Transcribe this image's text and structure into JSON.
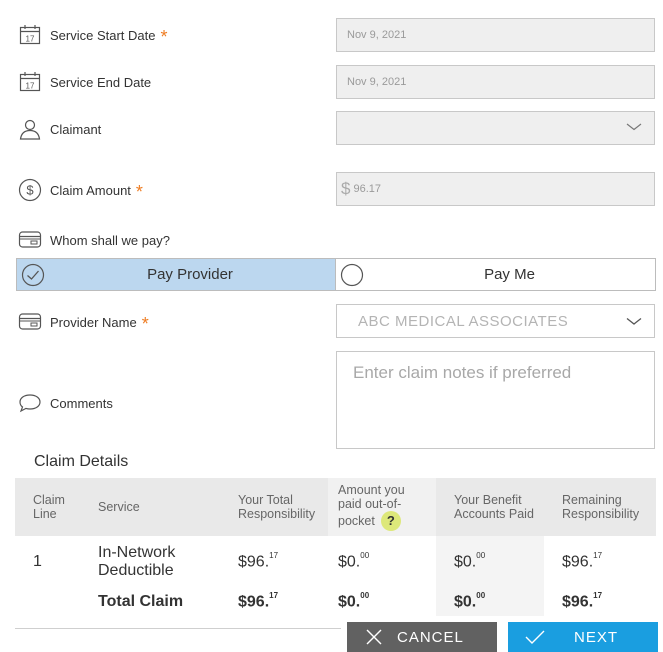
{
  "form": {
    "service_start_date": {
      "label": "Service Start Date",
      "required": "*",
      "value": "Nov 9, 2021",
      "icon": "calendar-icon",
      "icon_day": "17"
    },
    "service_end_date": {
      "label": "Service End Date",
      "value": "Nov 9, 2021",
      "icon": "calendar-icon",
      "icon_day": "17"
    },
    "claimant": {
      "label": "Claimant",
      "value": "",
      "icon": "person-icon"
    },
    "claim_amount": {
      "label": "Claim Amount",
      "required": "*",
      "currency": "$",
      "value": "96.17",
      "icon": "dollar-circle-icon"
    },
    "whom_pay": {
      "label": "Whom shall we pay?",
      "icon": "card-icon"
    },
    "pay_options": {
      "provider": "Pay Provider",
      "me": "Pay Me",
      "selected": "provider"
    },
    "provider_name": {
      "label": "Provider Name",
      "required": "*",
      "value": "ABC MEDICAL ASSOCIATES",
      "icon": "card-icon"
    },
    "comments": {
      "label": "Comments",
      "placeholder": "Enter claim notes if preferred",
      "icon": "speech-bubble-icon"
    }
  },
  "claim_details": {
    "title": "Claim Details",
    "headers": [
      "Claim Line",
      "Service",
      "Your Total Responsibility",
      "Amount you paid out-of-pocket",
      "Your Benefit Accounts Paid",
      "Remaining Responsibility"
    ],
    "help_icon": "?",
    "row": {
      "line": "1",
      "service": "In-Network Deductible",
      "total_int": "$96.",
      "total_dec": "17",
      "paid_int": "$0.",
      "paid_dec": "00",
      "benefit_int": "$0.",
      "benefit_dec": "00",
      "remaining_int": "$96.",
      "remaining_dec": "17"
    },
    "total": {
      "label": "Total Claim",
      "total_int": "$96.",
      "total_dec": "17",
      "paid_int": "$0.",
      "paid_dec": "00",
      "benefit_int": "$0.",
      "benefit_dec": "00",
      "remaining_int": "$96.",
      "remaining_dec": "17"
    }
  },
  "buttons": {
    "cancel": "CANCEL",
    "next": "NEXT"
  },
  "colors": {
    "accent_required": "#ee7c22",
    "selected_toggle": "#bcd7ef",
    "cancel_bg": "#616161",
    "next_bg": "#1a9ee0",
    "help_badge": "#dde87a"
  }
}
